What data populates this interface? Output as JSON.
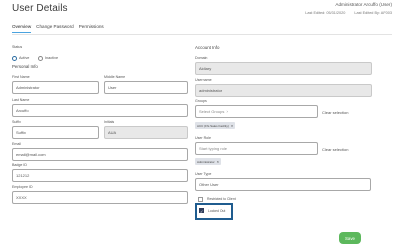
{
  "header": {
    "title": "User Details",
    "user_line": "Administrator Arcuffo (User)",
    "last_edited": "Last Edited: 05/31/2020",
    "last_edited_by": "Last Edited By: AF003"
  },
  "tabs": [
    "Overview",
    "Change Password",
    "Permissions"
  ],
  "status": {
    "label": "Status",
    "options": [
      {
        "label": "Active",
        "selected": true
      },
      {
        "label": "Inactive",
        "selected": false
      }
    ]
  },
  "personal": {
    "section": "Personal Info",
    "first_name": {
      "label": "First Name",
      "value": "Administrator"
    },
    "middle_name": {
      "label": "Middle Name",
      "value": "User"
    },
    "last_name": {
      "label": "Last Name",
      "value": "Arcuffo"
    },
    "suffix": {
      "label": "Suffix",
      "value": "Suffix"
    },
    "initials": {
      "label": "Initials",
      "value": "AUA"
    },
    "email": {
      "label": "Email",
      "value": "email@mail.com"
    },
    "badge_id": {
      "label": "Badge ID",
      "value": "121212"
    },
    "employee_id": {
      "label": "Employee ID",
      "value": "XXXX"
    }
  },
  "account": {
    "section": "Account Info",
    "domain": {
      "label": "Domain",
      "value": "Aidiary"
    },
    "username": {
      "label": "Username",
      "value": "administrator"
    },
    "groups": {
      "label": "Groups",
      "placeholder": "Select Groups",
      "chip": "ACC (Ffs Sales Facility)",
      "clear": "Clear selection"
    },
    "user_role": {
      "label": "User Role",
      "placeholder": "Start typing role",
      "chip": "Administrator",
      "clear": "Clear selection"
    },
    "user_type": {
      "label": "User Type",
      "value": "Other User"
    },
    "restricted": {
      "label": "Restricted to Client",
      "checked": false
    },
    "locked_out": {
      "label": "Locked Out",
      "checked": true
    }
  },
  "actions": {
    "save": "Save"
  },
  "colors": {
    "accent": "#4aa3df",
    "save": "#5cb85c",
    "highlight": "#1f5c8f",
    "chip": "#dfe2e8"
  }
}
